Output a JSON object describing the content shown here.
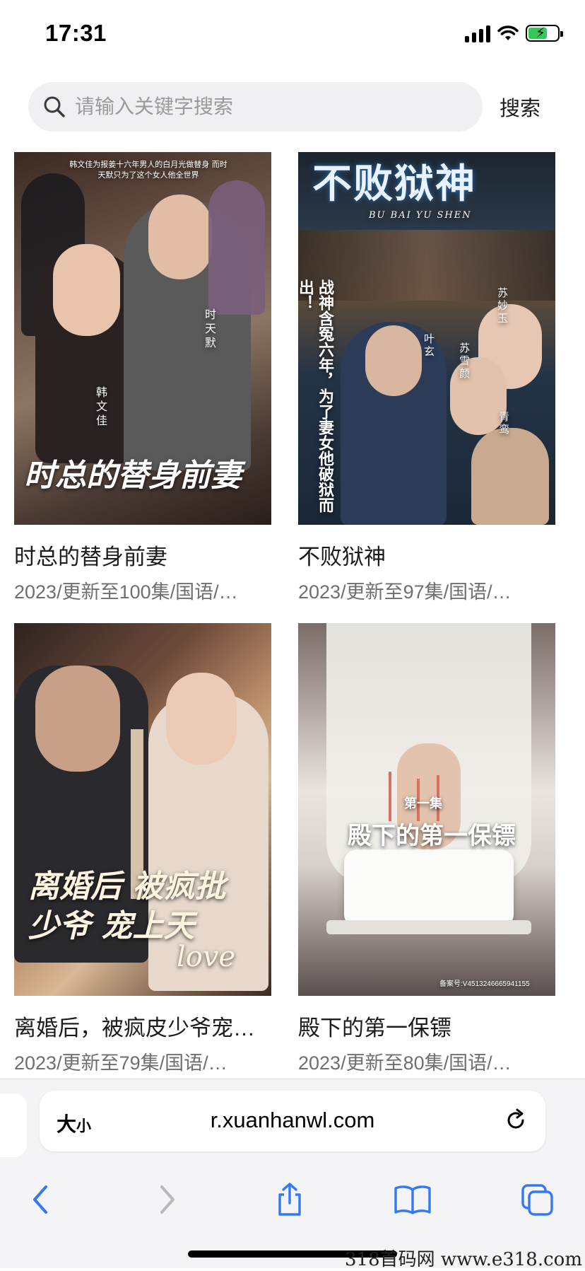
{
  "status": {
    "time": "17:31"
  },
  "search": {
    "placeholder": "请输入关键字搜索",
    "button_label": "搜索"
  },
  "items": [
    {
      "title": "时总的替身前妻",
      "meta": "2023/更新至100集/国语/…",
      "poster_text": "时总的替身前妻",
      "poster_caption": "韩文佳为报姜十六年男人的白月光做替身 而时天默只为了这个女人他全世界",
      "names": [
        "时天默",
        "韩文佳"
      ]
    },
    {
      "title": "不败狱神",
      "meta": "2023/更新至97集/国语/…",
      "poster_text": "不败狱神",
      "poster_sub": "BU BAI YU SHEN",
      "tagline": "战神含冤六年，为了妻女他破狱而出！",
      "names": [
        "叶玄",
        "苏妙玉",
        "苏雪颜",
        "青鸾"
      ]
    },
    {
      "title": "离婚后，被疯皮少爷宠…",
      "meta": "2023/更新至79集/国语/…",
      "poster_text": "离婚后 被疯批少爷 宠上天",
      "poster_love": "love"
    },
    {
      "title": "殿下的第一保镖",
      "meta": "2023/更新至80集/国语/…",
      "poster_text": "殿下的第一保镖",
      "episode": "第一集",
      "record_no": "备案号:V4513246665941155"
    }
  ],
  "browser": {
    "text_size_big": "大",
    "text_size_small": "小",
    "url": "r.xuanhanwl.com"
  },
  "watermark": "318首码网  www.e318.com",
  "colors": {
    "battery": "#34c759",
    "ios_blue": "#3478f6"
  }
}
